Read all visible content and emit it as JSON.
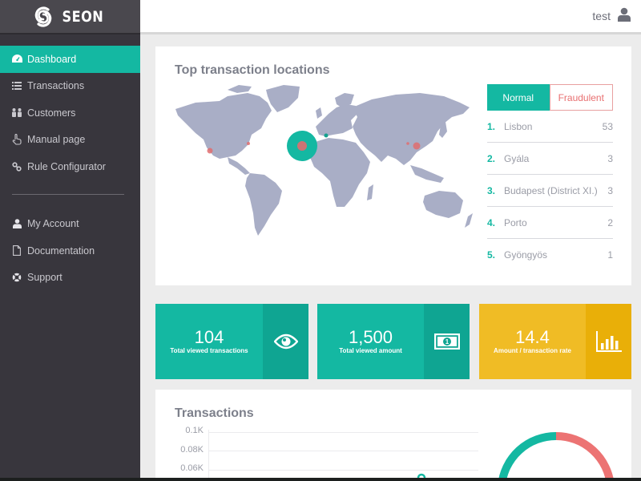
{
  "app": {
    "brand": "SEON"
  },
  "colors": {
    "accent": "#14b8a2",
    "fraud": "#e86f70",
    "warning": "#f0bc25",
    "sidebar": "#38363d"
  },
  "sidebar": {
    "items": [
      {
        "label": "Dashboard",
        "icon": "dashboard-icon",
        "active": true
      },
      {
        "label": "Transactions",
        "icon": "list-icon"
      },
      {
        "label": "Customers",
        "icon": "users-icon"
      },
      {
        "label": "Manual page",
        "icon": "hand-pointer-icon"
      },
      {
        "label": "Rule Configurator",
        "icon": "link-icon"
      }
    ],
    "secondary_items": [
      {
        "label": "My Account",
        "icon": "user-icon"
      },
      {
        "label": "Documentation",
        "icon": "file-icon"
      },
      {
        "label": "Support",
        "icon": "life-ring-icon"
      }
    ]
  },
  "header": {
    "user_name": "test",
    "user_icon": "user-icon"
  },
  "locations": {
    "title": "Top transaction locations",
    "tabs": [
      {
        "label": "Normal",
        "active": true
      },
      {
        "label": "Fraudulent",
        "active": false
      }
    ],
    "list": [
      {
        "rank": "1.",
        "name": "Lisbon",
        "count": "53"
      },
      {
        "rank": "2.",
        "name": "Gyála",
        "count": "3"
      },
      {
        "rank": "3.",
        "name": "Budapest (District XI.)",
        "count": "3"
      },
      {
        "rank": "4.",
        "name": "Porto",
        "count": "2"
      },
      {
        "rank": "5.",
        "name": "Gyöngyös",
        "count": "1"
      }
    ]
  },
  "stats": [
    {
      "value": "104",
      "label": "Total viewed transactions",
      "icon": "eye-icon"
    },
    {
      "value": "1,500",
      "label": "Total viewed amount",
      "icon": "money-bill-icon"
    },
    {
      "value": "14.4",
      "label": "Amount / transaction rate",
      "icon": "bar-chart-icon"
    }
  ],
  "transactions": {
    "title": "Transactions",
    "y_ticks": [
      "0.1K",
      "0.08K",
      "0.06K"
    ]
  }
}
